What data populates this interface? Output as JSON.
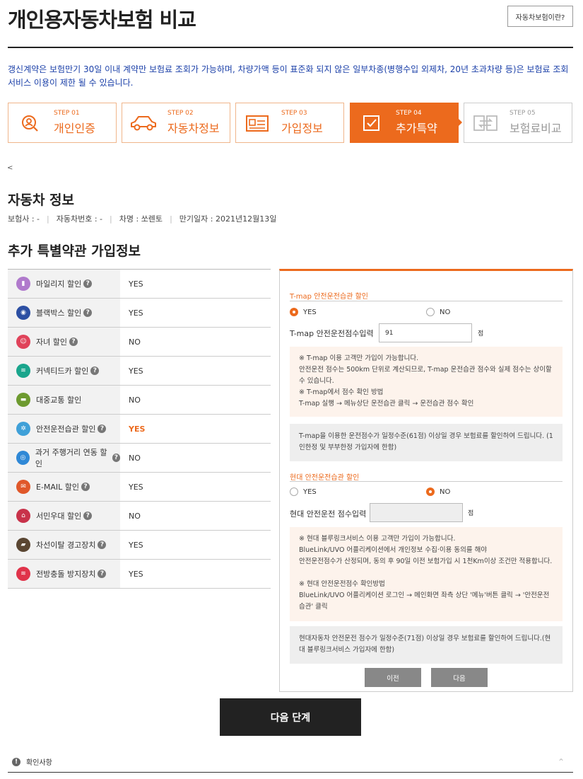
{
  "header": {
    "title": "개인용자동차보험 비교",
    "help_button": "자동차보험이란?"
  },
  "notice": "갱신계약은 보험만기 30일 이내 계약만 보험료 조회가 가능하며, 차량가액 등이 표준화 되지 않은 일부차종(병행수입 외제차, 20년 초과차량 등)은 보험료 조회서비스 이용이 제한 될 수 있습니다.",
  "steps": [
    {
      "no": "STEP 01",
      "label": "개인인증",
      "icon": "person-search-icon",
      "state": "done"
    },
    {
      "no": "STEP 02",
      "label": "자동차정보",
      "icon": "car-icon",
      "state": "done"
    },
    {
      "no": "STEP 03",
      "label": "가입정보",
      "icon": "id-card-icon",
      "state": "done"
    },
    {
      "no": "STEP 04",
      "label": "추가특약",
      "icon": "checkbox-icon",
      "state": "active"
    },
    {
      "no": "STEP 05",
      "label": "보험료비교",
      "icon": "compare-icon",
      "state": "disabled"
    }
  ],
  "back_link": "<",
  "car_section": {
    "title": "자동차 정보",
    "info": [
      "보험사 : -",
      "자동차번호 : -",
      "차명 : 쏘렌토",
      "만기일자 : 2021년12월13일"
    ]
  },
  "special_section": {
    "title": "추가 특별약관 가입정보",
    "rows": [
      {
        "label": "마일리지 할인",
        "value": "YES",
        "icon": "mileage-icon",
        "color": "#b07acc"
      },
      {
        "label": "블랙박스 할인",
        "value": "YES",
        "icon": "blackbox-icon",
        "color": "#2c4fa3"
      },
      {
        "label": "자녀 할인",
        "value": "NO",
        "icon": "child-icon",
        "color": "#e0435a"
      },
      {
        "label": "커넥티드카 할인",
        "value": "YES",
        "icon": "connected-car-icon",
        "color": "#19a58c"
      },
      {
        "label": "대중교통 할인",
        "value": "NO",
        "icon": "bus-icon",
        "color": "#6d9a2f"
      },
      {
        "label": "안전운전습관 할인",
        "value": "YES",
        "icon": "safe-driving-icon",
        "color": "#3fa0d8",
        "highlight": true
      },
      {
        "label": "과거 주행거리 연동 할인",
        "value": "NO",
        "icon": "odometer-icon",
        "color": "#2f88d6"
      },
      {
        "label": "E-MAIL 할인",
        "value": "YES",
        "icon": "email-icon",
        "color": "#e0582a"
      },
      {
        "label": "서민우대 할인",
        "value": "NO",
        "icon": "shop-icon",
        "color": "#c8324a"
      },
      {
        "label": "차선이탈 경고장치",
        "value": "YES",
        "icon": "lane-warning-icon",
        "color": "#5a4632"
      },
      {
        "label": "전방충돌 방지장치",
        "value": "YES",
        "icon": "collision-icon",
        "color": "#e0334a"
      }
    ]
  },
  "tmap": {
    "title": "T-map 안전운전습관 할인",
    "yes": "YES",
    "no": "NO",
    "selected": "YES",
    "input_label": "T-map 안전운전점수입력",
    "input_value": "91",
    "unit": "점",
    "note_lines": [
      "※ T-map 이용 고객만 가입이 가능합니다.",
      "안전운전 점수는 500km 단위로 계산되므로, T-map 운전습관 점수와 실제 점수는 상이할 수 있습니다.",
      "※ T-map에서 점수 확인 방법",
      "T-map 실행 → 메뉴상단 운전습관 클릭 → 운전습관 점수 확인"
    ],
    "info": "T-map을 이용한 운전점수가 일정수준(61점) 이상일 경우 보험료를 할인하여 드립니다. (1인한정 및 부부한정 가입자에 한함)"
  },
  "hyundai": {
    "title": "현대 안전운전습관 할인",
    "yes": "YES",
    "no": "NO",
    "selected": "NO",
    "input_label": "현대 안전운전 점수입력",
    "input_value": "",
    "unit": "점",
    "note_lines": [
      "※ 현대 블루링크서비스 이용 고객만 가입이 가능합니다.",
      "BlueLink/UVO 어플리케이션에서 개인정보 수집·이용 동의를 해야",
      "안전운전점수가 산정되며, 동의 후 90일 이전 보험가입 시 1천Km이상 조건만 적용합니다.",
      "",
      "※ 현대 안전운전점수 확인방법",
      "BlueLink/UVO 어플리케이션 로그인 → 메인화면 좌측 상단 '메뉴'버튼 클릭 → '안전운전습관' 클릭"
    ],
    "info": "현대자동차 안전운전 점수가 일정수준(71점) 이상일 경우 보험료를 할인하여 드립니다.(현대 블루링크서비스 가입자에 한함)"
  },
  "buttons": {
    "prev": "이전",
    "next": "다음",
    "next_step": "다음 단계"
  },
  "confirm": {
    "label": "확인사항",
    "chevron": "⌃"
  },
  "colors": {
    "accent": "#ec6a1d",
    "link_blue": "#1a3fa8"
  }
}
